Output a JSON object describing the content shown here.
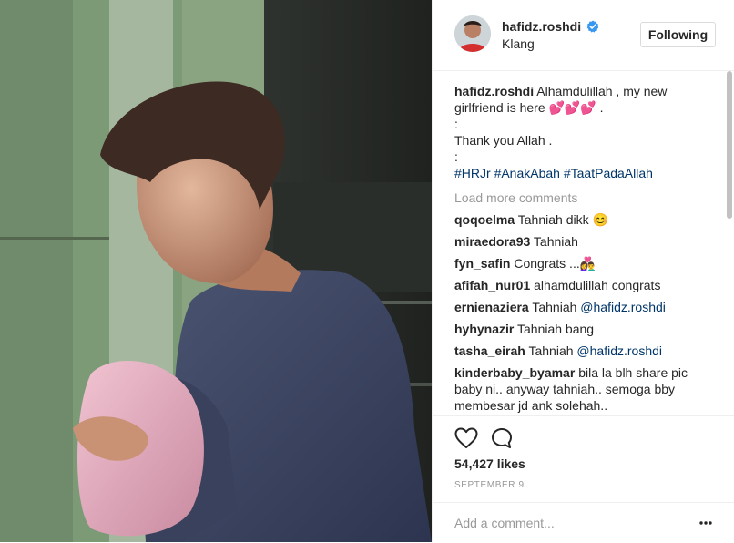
{
  "post": {
    "username": "hafidz.roshdi",
    "location": "Klang",
    "follow_label": "Following",
    "caption_user": "hafidz.roshdi",
    "caption_line1": "Alhamdulillah , my new girlfriend is here 💕💕💕 .",
    "caption_sep1": ":",
    "caption_line2": "Thank you Allah .",
    "caption_sep2": ":",
    "hashtags": [
      "#HRJr",
      "#AnakAbah",
      "#TaatPadaAllah"
    ],
    "load_more": "Load more comments",
    "comments": [
      {
        "user": "qoqoelma",
        "text": "Tahniah dikk 😊"
      },
      {
        "user": "miraedora93",
        "text": "Tahniah"
      },
      {
        "user": "fyn_safin",
        "text": "Congrats ...👩‍❤️‍👨"
      },
      {
        "user": "afifah_nur01",
        "text": "alhamdulillah congrats"
      },
      {
        "user": "ernienaziera",
        "text": "Tahniah ",
        "mention": "@hafidz.roshdi"
      },
      {
        "user": "hyhynazir",
        "text": "Tahniah bang"
      },
      {
        "user": "tasha_eirah",
        "text": "Tahniah ",
        "mention": "@hafidz.roshdi"
      },
      {
        "user": "kinderbaby_byamar",
        "text": "bila la blh share pic baby ni.. anyway tahniah.. semoga bby membesar jd ank solehah.."
      }
    ],
    "likes": "54,427 likes",
    "date": "SEPTEMBER 9",
    "add_comment_placeholder": "Add a comment..."
  },
  "icons": {
    "verified": "verified-badge-icon",
    "like": "heart-icon",
    "comment": "speech-bubble-icon",
    "more": "more-options-icon"
  },
  "colors": {
    "link": "#003569",
    "verified": "#3897f0",
    "muted": "#999999",
    "border": "#efefef"
  }
}
